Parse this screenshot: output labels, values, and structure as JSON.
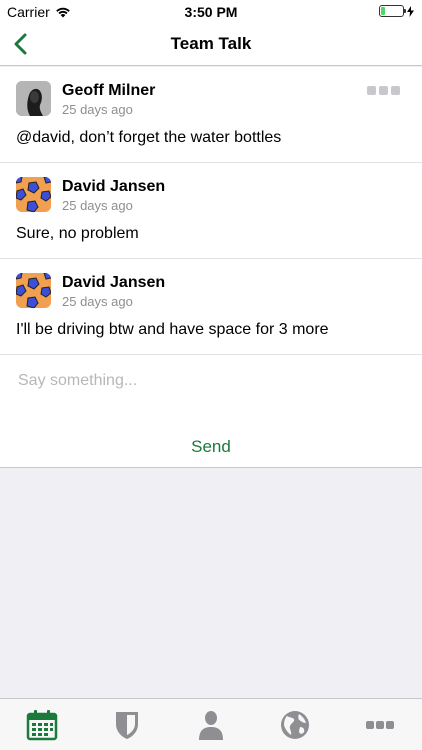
{
  "status_bar": {
    "carrier": "Carrier",
    "time": "3:50 PM",
    "battery_level": 0.2
  },
  "nav": {
    "title": "Team Talk",
    "back_icon": "chevron-left-icon"
  },
  "messages": [
    {
      "author": "Geoff Milner",
      "time": "25 days ago",
      "text": "@david, don’t forget the water bottles",
      "avatar": "person-photo",
      "has_menu": true
    },
    {
      "author": "David Jansen",
      "time": "25 days ago",
      "text": "Sure, no problem",
      "avatar": "soccer-ball"
    },
    {
      "author": "David Jansen",
      "time": "25 days ago",
      "text": "I'll be driving btw and have space for 3 more",
      "avatar": "soccer-ball"
    }
  ],
  "compose": {
    "placeholder": "Say something...",
    "value": "",
    "send_label": "Send"
  },
  "tabs": [
    {
      "name": "calendar-icon",
      "active": true
    },
    {
      "name": "shield-icon",
      "active": false
    },
    {
      "name": "person-icon",
      "active": false
    },
    {
      "name": "globe-icon",
      "active": false
    },
    {
      "name": "more-icon",
      "active": false
    }
  ],
  "colors": {
    "accent": "#1a7a3c",
    "inactive_icon": "#8e8e93",
    "background": "#efeff4"
  }
}
